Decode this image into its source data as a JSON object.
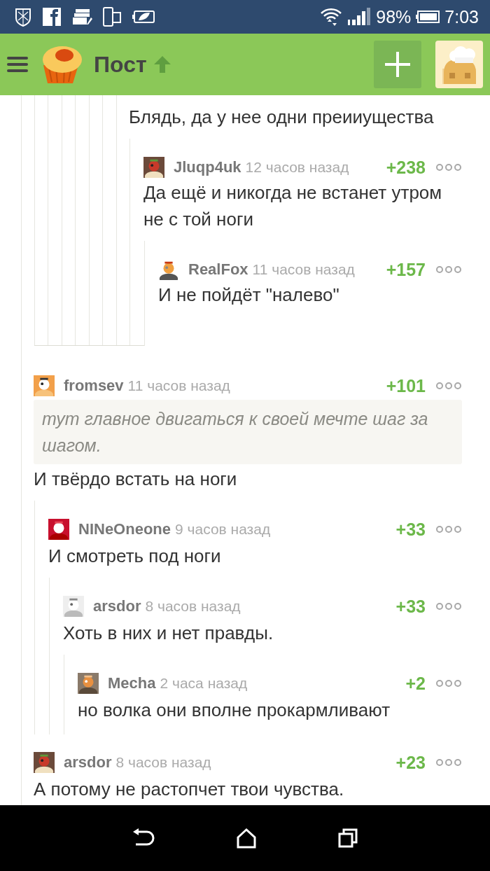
{
  "status_bar": {
    "battery": "98%",
    "time": "7:03"
  },
  "app_bar": {
    "title": "Пост"
  },
  "continued_thread": [
    {
      "text": "Блядь, да у нее одни преииущества",
      "children": [
        {
          "author": "Jluqp4uk",
          "time": "12 часов назад",
          "rating": "+238",
          "text": "Да ещё и никогда не встанет утром не с той ноги",
          "children": [
            {
              "author": "RealFox",
              "time": "11 часов назад",
              "rating": "+157",
              "text": "И не пойдёт \"налево\""
            }
          ]
        }
      ]
    }
  ],
  "comments": [
    {
      "author": "fromsev",
      "time": "11 часов назад",
      "rating": "+101",
      "quote": "тут главное двигаться к своей мечте шаг за шагом.",
      "text": "И твёрдо встать на ноги",
      "children": [
        {
          "author": "NINeOneone",
          "time": "9 часов назад",
          "rating": "+33",
          "text": "И смотреть под ноги",
          "children": [
            {
              "author": "arsdor",
              "time": "8 часов назад",
              "rating": "+33",
              "text": "Хоть в них и нет правды.",
              "children": [
                {
                  "author": "Mecha",
                  "time": "2 часа назад",
                  "rating": "+2",
                  "text": "но волка они вполне прокармливают"
                }
              ]
            }
          ]
        }
      ]
    },
    {
      "author": "arsdor",
      "time": "8 часов назад",
      "rating": "+23",
      "text": "А потому не растопчет твои чувства."
    }
  ]
}
